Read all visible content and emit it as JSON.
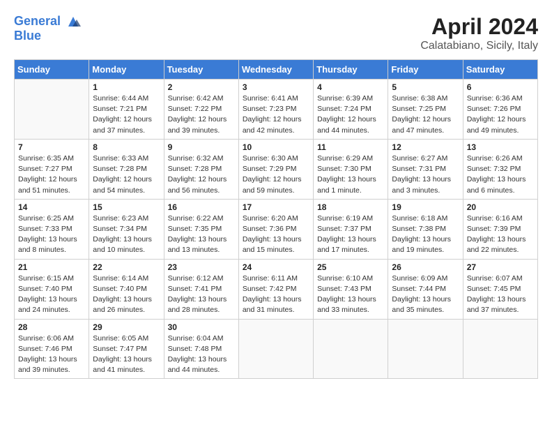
{
  "header": {
    "logo_line1": "General",
    "logo_line2": "Blue",
    "month_title": "April 2024",
    "location": "Calatabiano, Sicily, Italy"
  },
  "weekdays": [
    "Sunday",
    "Monday",
    "Tuesday",
    "Wednesday",
    "Thursday",
    "Friday",
    "Saturday"
  ],
  "weeks": [
    [
      {
        "day": "",
        "info": ""
      },
      {
        "day": "1",
        "info": "Sunrise: 6:44 AM\nSunset: 7:21 PM\nDaylight: 12 hours\nand 37 minutes."
      },
      {
        "day": "2",
        "info": "Sunrise: 6:42 AM\nSunset: 7:22 PM\nDaylight: 12 hours\nand 39 minutes."
      },
      {
        "day": "3",
        "info": "Sunrise: 6:41 AM\nSunset: 7:23 PM\nDaylight: 12 hours\nand 42 minutes."
      },
      {
        "day": "4",
        "info": "Sunrise: 6:39 AM\nSunset: 7:24 PM\nDaylight: 12 hours\nand 44 minutes."
      },
      {
        "day": "5",
        "info": "Sunrise: 6:38 AM\nSunset: 7:25 PM\nDaylight: 12 hours\nand 47 minutes."
      },
      {
        "day": "6",
        "info": "Sunrise: 6:36 AM\nSunset: 7:26 PM\nDaylight: 12 hours\nand 49 minutes."
      }
    ],
    [
      {
        "day": "7",
        "info": "Sunrise: 6:35 AM\nSunset: 7:27 PM\nDaylight: 12 hours\nand 51 minutes."
      },
      {
        "day": "8",
        "info": "Sunrise: 6:33 AM\nSunset: 7:28 PM\nDaylight: 12 hours\nand 54 minutes."
      },
      {
        "day": "9",
        "info": "Sunrise: 6:32 AM\nSunset: 7:28 PM\nDaylight: 12 hours\nand 56 minutes."
      },
      {
        "day": "10",
        "info": "Sunrise: 6:30 AM\nSunset: 7:29 PM\nDaylight: 12 hours\nand 59 minutes."
      },
      {
        "day": "11",
        "info": "Sunrise: 6:29 AM\nSunset: 7:30 PM\nDaylight: 13 hours\nand 1 minute."
      },
      {
        "day": "12",
        "info": "Sunrise: 6:27 AM\nSunset: 7:31 PM\nDaylight: 13 hours\nand 3 minutes."
      },
      {
        "day": "13",
        "info": "Sunrise: 6:26 AM\nSunset: 7:32 PM\nDaylight: 13 hours\nand 6 minutes."
      }
    ],
    [
      {
        "day": "14",
        "info": "Sunrise: 6:25 AM\nSunset: 7:33 PM\nDaylight: 13 hours\nand 8 minutes."
      },
      {
        "day": "15",
        "info": "Sunrise: 6:23 AM\nSunset: 7:34 PM\nDaylight: 13 hours\nand 10 minutes."
      },
      {
        "day": "16",
        "info": "Sunrise: 6:22 AM\nSunset: 7:35 PM\nDaylight: 13 hours\nand 13 minutes."
      },
      {
        "day": "17",
        "info": "Sunrise: 6:20 AM\nSunset: 7:36 PM\nDaylight: 13 hours\nand 15 minutes."
      },
      {
        "day": "18",
        "info": "Sunrise: 6:19 AM\nSunset: 7:37 PM\nDaylight: 13 hours\nand 17 minutes."
      },
      {
        "day": "19",
        "info": "Sunrise: 6:18 AM\nSunset: 7:38 PM\nDaylight: 13 hours\nand 19 minutes."
      },
      {
        "day": "20",
        "info": "Sunrise: 6:16 AM\nSunset: 7:39 PM\nDaylight: 13 hours\nand 22 minutes."
      }
    ],
    [
      {
        "day": "21",
        "info": "Sunrise: 6:15 AM\nSunset: 7:40 PM\nDaylight: 13 hours\nand 24 minutes."
      },
      {
        "day": "22",
        "info": "Sunrise: 6:14 AM\nSunset: 7:40 PM\nDaylight: 13 hours\nand 26 minutes."
      },
      {
        "day": "23",
        "info": "Sunrise: 6:12 AM\nSunset: 7:41 PM\nDaylight: 13 hours\nand 28 minutes."
      },
      {
        "day": "24",
        "info": "Sunrise: 6:11 AM\nSunset: 7:42 PM\nDaylight: 13 hours\nand 31 minutes."
      },
      {
        "day": "25",
        "info": "Sunrise: 6:10 AM\nSunset: 7:43 PM\nDaylight: 13 hours\nand 33 minutes."
      },
      {
        "day": "26",
        "info": "Sunrise: 6:09 AM\nSunset: 7:44 PM\nDaylight: 13 hours\nand 35 minutes."
      },
      {
        "day": "27",
        "info": "Sunrise: 6:07 AM\nSunset: 7:45 PM\nDaylight: 13 hours\nand 37 minutes."
      }
    ],
    [
      {
        "day": "28",
        "info": "Sunrise: 6:06 AM\nSunset: 7:46 PM\nDaylight: 13 hours\nand 39 minutes."
      },
      {
        "day": "29",
        "info": "Sunrise: 6:05 AM\nSunset: 7:47 PM\nDaylight: 13 hours\nand 41 minutes."
      },
      {
        "day": "30",
        "info": "Sunrise: 6:04 AM\nSunset: 7:48 PM\nDaylight: 13 hours\nand 44 minutes."
      },
      {
        "day": "",
        "info": ""
      },
      {
        "day": "",
        "info": ""
      },
      {
        "day": "",
        "info": ""
      },
      {
        "day": "",
        "info": ""
      }
    ]
  ]
}
